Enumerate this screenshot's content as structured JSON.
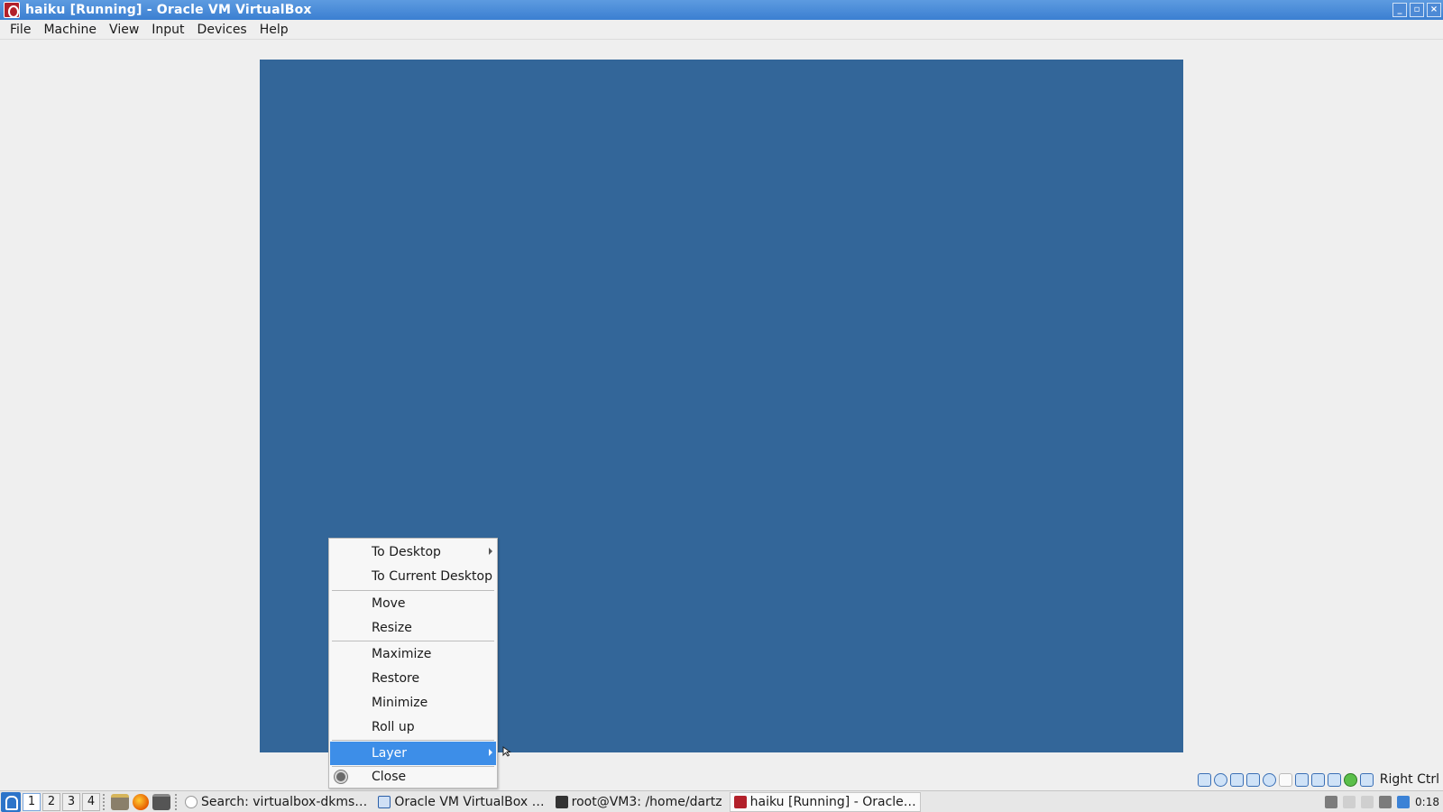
{
  "window": {
    "title": "haiku [Running] - Oracle VM VirtualBox",
    "buttons": [
      "minimize",
      "restore",
      "close"
    ]
  },
  "menubar": [
    "File",
    "Machine",
    "View",
    "Input",
    "Devices",
    "Help"
  ],
  "vm_display": {
    "background_color": "#336699"
  },
  "status_bar": {
    "icons": [
      "hard-disk-icon",
      "optical-drive-icon",
      "audio-icon",
      "network-icon",
      "usb-icon",
      "shared-folders-icon",
      "display-icon",
      "video-capture-icon",
      "virtualization-icon",
      "mouse-integration-icon",
      "keyboard-icon"
    ],
    "host_key": "Right Ctrl"
  },
  "context_menu": {
    "items": [
      {
        "label": "To Desktop",
        "submenu": true
      },
      {
        "label": "To Current Desktop"
      },
      {
        "label": "Move"
      },
      {
        "label": "Resize"
      },
      {
        "label": "Maximize"
      },
      {
        "label": "Restore"
      },
      {
        "label": "Minimize"
      },
      {
        "label": "Roll up"
      },
      {
        "label": "Layer",
        "submenu": true,
        "highlighted": true
      },
      {
        "label": "Close",
        "icon": "close-radio-icon"
      }
    ]
  },
  "taskbar": {
    "desktops": [
      "1",
      "2",
      "3",
      "4"
    ],
    "active_desktop": "1",
    "launchers": [
      "file-manager-icon",
      "firefox-icon",
      "terminal-icon"
    ],
    "tasks": [
      {
        "label": "Search: virtualbox-dkms…",
        "icon": "search-icon"
      },
      {
        "label": "Oracle VM VirtualBox …",
        "icon": "virtualbox-icon"
      },
      {
        "label": "root@VM3: /home/dartz",
        "icon": "terminal-icon"
      },
      {
        "label": "haiku [Running] - Oracle…",
        "icon": "haiku-icon",
        "active": true
      }
    ],
    "clock": "0:18"
  },
  "colors": {
    "titlebar": "#3b7fd1",
    "menu_highlight": "#3d8ee8",
    "vm_background": "#336699"
  }
}
